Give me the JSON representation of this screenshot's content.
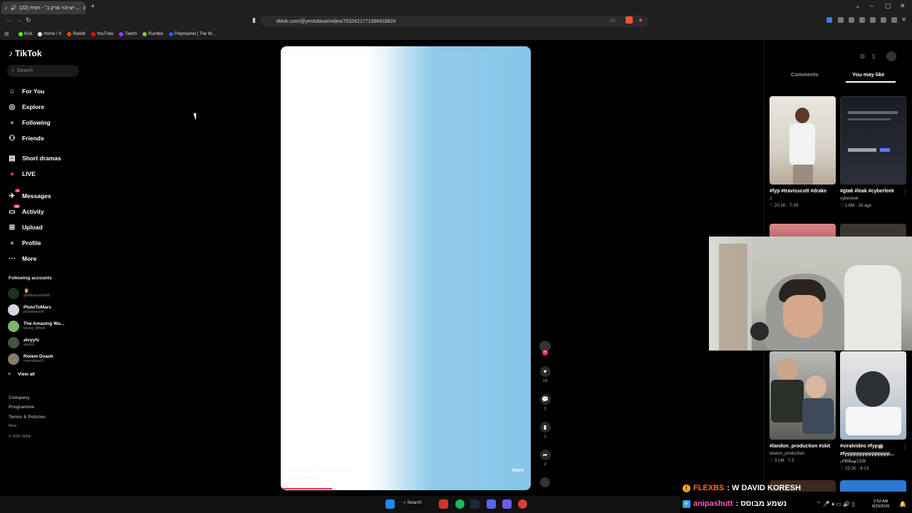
{
  "browser": {
    "tab_title": "יש זכר מרק ב׳ - תורה (22) ...",
    "url": "tiktok.com/@yeshdavar/video/7532421771396418824",
    "bookmarks": [
      {
        "label": "Kick",
        "color": "#53fc18"
      },
      {
        "label": "Home / X",
        "color": "#ffffff"
      },
      {
        "label": "Reddit",
        "color": "#ff4500"
      },
      {
        "label": "YouTube",
        "color": "#ff0000"
      },
      {
        "label": "Twitch",
        "color": "#9146ff"
      },
      {
        "label": "Rumble",
        "color": "#85c742"
      },
      {
        "label": "Polymarket | The W...",
        "color": "#2e5cff"
      }
    ]
  },
  "sidebar": {
    "logo": "TikTok",
    "search_placeholder": "Search",
    "nav": [
      {
        "label": "For You",
        "icon": "home-icon",
        "glyph": "⌂"
      },
      {
        "label": "Explore",
        "icon": "compass-icon",
        "glyph": "◎"
      },
      {
        "label": "Following",
        "icon": "following-avatar-icon",
        "glyph": "●"
      },
      {
        "label": "Friends",
        "icon": "friends-icon",
        "glyph": "⚇"
      },
      {
        "label": "Short dramas",
        "icon": "film-icon",
        "glyph": "▤"
      },
      {
        "label": "LIVE",
        "icon": "live-icon",
        "glyph": "●"
      },
      {
        "label": "Messages",
        "icon": "paper-plane-icon",
        "glyph": "✈",
        "badge": "2"
      },
      {
        "label": "Activity",
        "icon": "inbox-icon",
        "glyph": "▭",
        "badge": "15"
      },
      {
        "label": "Upload",
        "icon": "plus-box-icon",
        "glyph": "⊞"
      },
      {
        "label": "Profile",
        "icon": "profile-avatar-icon",
        "glyph": "●"
      },
      {
        "label": "More",
        "icon": "more-dots-icon",
        "glyph": "···"
      }
    ],
    "following_title": "Following accounts",
    "accounts": [
      {
        "name": "🦉",
        "handle": "getittheyoullveittt",
        "color": "#203020"
      },
      {
        "name": "PlutoToMars",
        "handle": "plutotomars8",
        "color": "#cfd8e0"
      },
      {
        "name": "The Amazing Wo...",
        "handle": "tawog_official",
        "color": "#7fb36b"
      },
      {
        "name": "alvyytv",
        "handle": "alvyytv",
        "color": "#445544"
      },
      {
        "name": "Rotem Dvash",
        "handle": "rotemdvash1",
        "color": "#8a7a6a"
      }
    ],
    "view_all": "View all",
    "footer": [
      "Company",
      "Programme",
      "Terms & Policies"
    ],
    "footer_more": "More",
    "copyright": "© 2026 TikTok"
  },
  "video": {
    "caption_top": "לאזור יוצרים - מרק ב׳ - תורה",
    "caption_title": "יש זכר מרק ב׳ - תורה שבעל פה...",
    "more": "more",
    "see_translation": "See translation",
    "progress": 0.2
  },
  "actions": {
    "likes": "13",
    "comments": "3",
    "saves": "1",
    "shares": "2"
  },
  "right_panel": {
    "tabs": [
      "Comments",
      "You may like"
    ],
    "cards": [
      {
        "caption": "#fyp #travisscott #drake",
        "author": "J",
        "likes": "20.1K",
        "date": "7-29"
      },
      {
        "caption": "#gta6 #leak #cyberleek",
        "author": "cyberleek",
        "likes": "1.6M",
        "date": "2d ago"
      },
      {
        "caption": "#landon_production #skit",
        "author": "landon_production",
        "likes": "3.1M",
        "date": "7-2"
      },
      {
        "caption": "#viralvideo #fyp🤖 #fypppppppppppppp...",
        "author": "𝓝𝓒𝓡𝓪𝔂1538",
        "likes": "23.1K",
        "date": "8-13"
      }
    ]
  },
  "stream": {
    "chat1_user": "FLEXBS",
    "chat1_msg": ": W DAVID KORESH",
    "chat2_user": "anipashutt",
    "chat2_msg": ": נשמע מבוסס"
  },
  "taskbar": {
    "search": "Search",
    "time": "2:53 AM",
    "date": "8/23/2026"
  }
}
